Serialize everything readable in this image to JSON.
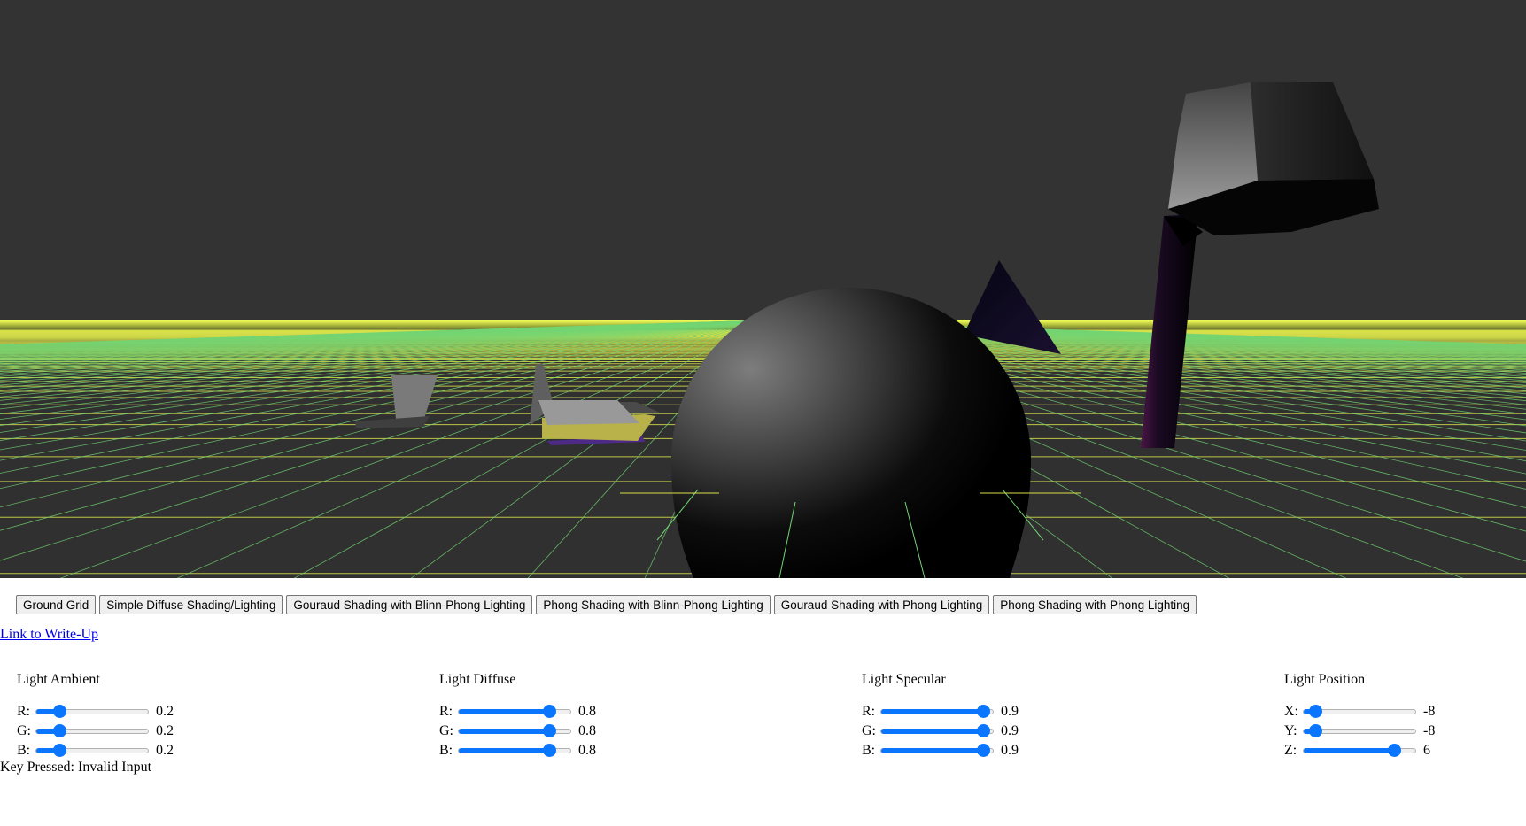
{
  "buttons": [
    "Ground Grid",
    "Simple Diffuse Shading/Lighting",
    "Gouraud Shading with Blinn-Phong Lighting",
    "Phong Shading with Blinn-Phong Lighting",
    "Gouraud Shading with Phong Lighting",
    "Phong Shading with Phong Lighting"
  ],
  "writeup_link": "Link to Write-Up",
  "groups": [
    {
      "title": "Light Ambient",
      "rows": [
        {
          "label": "R:",
          "value": "0.2",
          "fraction": 0.2
        },
        {
          "label": "G:",
          "value": "0.2",
          "fraction": 0.2
        },
        {
          "label": "B:",
          "value": "0.2",
          "fraction": 0.2
        }
      ]
    },
    {
      "title": "Light Diffuse",
      "rows": [
        {
          "label": "R:",
          "value": "0.8",
          "fraction": 0.8
        },
        {
          "label": "G:",
          "value": "0.8",
          "fraction": 0.8
        },
        {
          "label": "B:",
          "value": "0.8",
          "fraction": 0.8
        }
      ]
    },
    {
      "title": "Light Specular",
      "rows": [
        {
          "label": "R:",
          "value": "0.9",
          "fraction": 0.9
        },
        {
          "label": "G:",
          "value": "0.9",
          "fraction": 0.9
        },
        {
          "label": "B:",
          "value": "0.9",
          "fraction": 0.9
        }
      ]
    },
    {
      "title": "Light Position",
      "rows": [
        {
          "label": "X:",
          "value": "-8",
          "fraction": 0.1
        },
        {
          "label": "Y:",
          "value": "-8",
          "fraction": 0.1
        },
        {
          "label": "Z:",
          "value": "6",
          "fraction": 0.8
        }
      ]
    }
  ],
  "status": "Key Pressed: Invalid Input",
  "colors": {
    "accent": "#0a75ff",
    "sky": "#333333",
    "grid_horizontal": "#d7e14a",
    "grid_radial": "#73d473",
    "horizon_glow": "#f4ff5a"
  }
}
